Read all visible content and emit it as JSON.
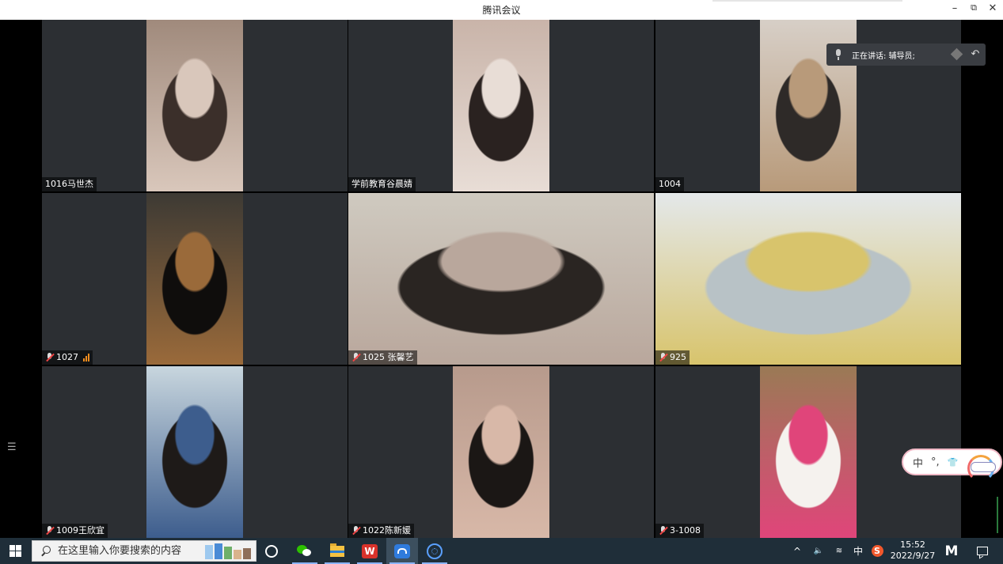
{
  "window": {
    "title": "腾讯会议",
    "controls": [
      "–",
      "⧉",
      "✕"
    ]
  },
  "speaking_banner": {
    "text": "正在讲话: 辅导员;"
  },
  "participants": [
    {
      "name": "1016马世杰",
      "muted": false,
      "signal_bars": 0,
      "video": "portrait",
      "palette": [
        "#a08a7c",
        "#3b2f2a",
        "#d9c7bb"
      ]
    },
    {
      "name": "学前教育谷晨婧",
      "muted": false,
      "signal_bars": 0,
      "video": "portrait",
      "palette": [
        "#c9b4a9",
        "#2a2220",
        "#e8ddd6"
      ]
    },
    {
      "name": "1004",
      "muted": false,
      "signal_bars": 0,
      "video": "portrait",
      "palette": [
        "#d7cfc7",
        "#2e2a28",
        "#b89a7a"
      ]
    },
    {
      "name": "1027",
      "muted": true,
      "signal_bars": 3,
      "video": "portrait",
      "palette": [
        "#3d3a34",
        "#0f0d0c",
        "#9a6a3a"
      ]
    },
    {
      "name": "1025 张馨艺",
      "muted": true,
      "signal_bars": 0,
      "video": "landscape",
      "palette": [
        "#cfcac0",
        "#2a2522",
        "#b9a79c"
      ]
    },
    {
      "name": "925",
      "muted": true,
      "signal_bars": 0,
      "video": "landscape",
      "palette": [
        "#e4e8ea",
        "#b8c2c6",
        "#d8c46c"
      ]
    },
    {
      "name": "1009王欣宜",
      "muted": true,
      "signal_bars": 0,
      "video": "portrait",
      "palette": [
        "#c8d6de",
        "#1e1a18",
        "#3d5d8d"
      ]
    },
    {
      "name": "1022陈新媛",
      "muted": true,
      "signal_bars": 0,
      "video": "portrait",
      "palette": [
        "#b79a8c",
        "#1b1715",
        "#d8b8a8"
      ]
    },
    {
      "name": "3-1008",
      "muted": true,
      "signal_bars": 0,
      "video": "portrait",
      "palette": [
        "#9a7a55",
        "#f5f2ee",
        "#e0457a"
      ]
    }
  ],
  "ime_toolbar": {
    "mode": "中",
    "punct": "°,",
    "skin": "👕"
  },
  "taskbar": {
    "search_placeholder": "在这里输入你要搜索的内容",
    "apps": [
      "cortana",
      "wechat",
      "file-explorer",
      "wps-office",
      "tencent-meeting",
      "media-player"
    ],
    "tray": {
      "chevron": "^",
      "volume": "🔊",
      "network": "📶",
      "ime": "中",
      "sogou": "S",
      "time": "15:52",
      "date": "2022/9/27",
      "logo": "M"
    }
  }
}
